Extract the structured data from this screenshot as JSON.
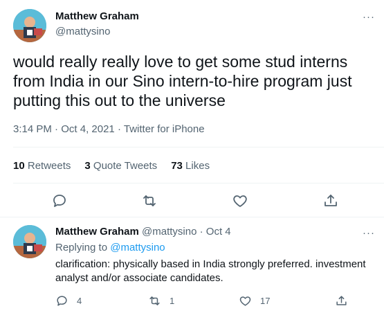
{
  "tweet": {
    "author_name": "Matthew Graham",
    "author_handle": "@mattysino",
    "text": "would really really love to get some stud interns from India in our Sino intern-to-hire program just putting this out to the universe",
    "time": "3:14 PM",
    "date": "Oct 4, 2021",
    "source": "Twitter for iPhone",
    "stats": {
      "retweets_count": "10",
      "retweets_label": "Retweets",
      "quotes_count": "3",
      "quotes_label": "Quote Tweets",
      "likes_count": "73",
      "likes_label": "Likes"
    }
  },
  "reply": {
    "author_name": "Matthew Graham",
    "author_handle": "@mattysino",
    "date": "Oct 4",
    "replying_prefix": "Replying to",
    "replying_handle": "@mattysino",
    "text": "clarification: physically based in India strongly preferred. investment analyst and/or associate candidates.",
    "counts": {
      "replies": "4",
      "retweets": "1",
      "likes": "17"
    }
  },
  "ui": {
    "more_glyph": "···",
    "meta_separator": "·",
    "icons": [
      "reply-icon",
      "retweet-icon",
      "like-icon",
      "share-icon",
      "more-options-icon"
    ],
    "colors": {
      "text": "#0f1419",
      "secondary": "#536471",
      "link": "#1d9bf0",
      "divider": "#eff3f4"
    }
  }
}
